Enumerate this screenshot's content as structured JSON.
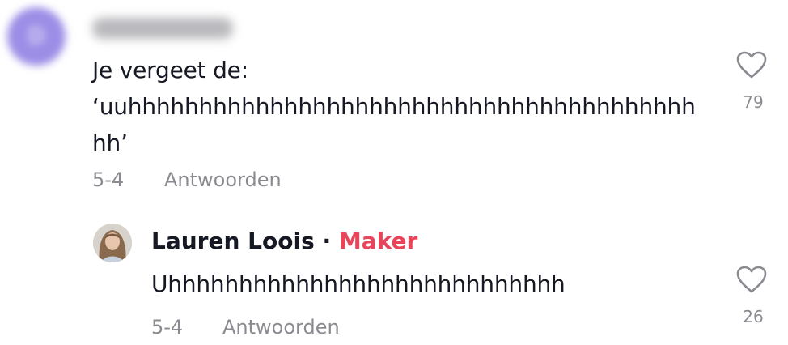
{
  "comment": {
    "avatar_letter": "D",
    "username": "dlhomaolc",
    "text": "Je vergeet de:\n‘uuhhhhhhhhhhhhhhhhhhhhhhhhhhhhhhhhhhhhhhhh\nhh’",
    "date": "5-4",
    "reply_label": "Antwoorden",
    "like_count": "79",
    "avatar_color": "#9c8de6"
  },
  "reply": {
    "username": "Lauren Loois",
    "separator": "·",
    "badge": "Maker",
    "text": "Uhhhhhhhhhhhhhhhhhhhhhhhhhhhh",
    "date": "5-4",
    "reply_label": "Antwoorden",
    "like_count": "26",
    "badge_color": "#e8445a"
  },
  "icons": {
    "like": "heart-outline-icon"
  }
}
